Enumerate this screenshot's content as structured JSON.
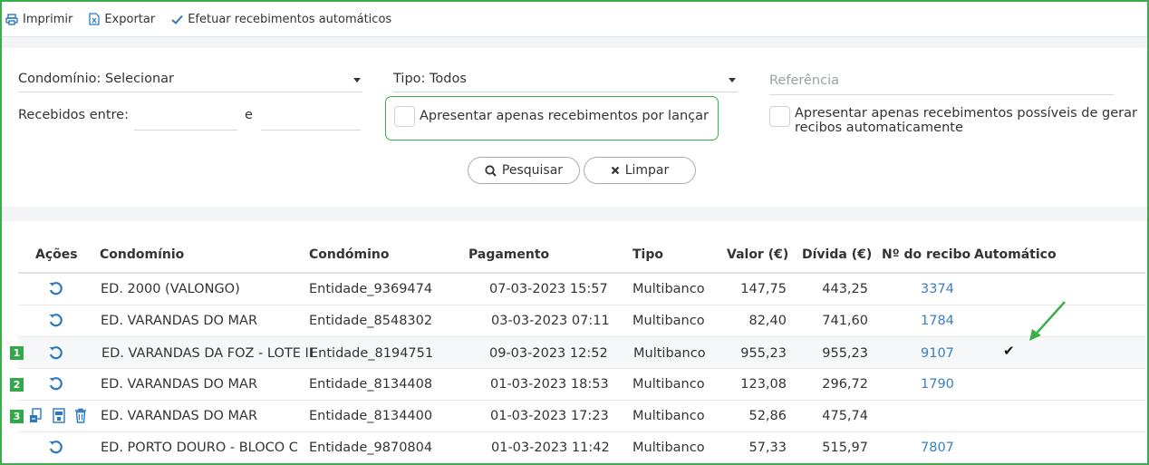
{
  "toolbar": {
    "print": "Imprimir",
    "export": "Exportar",
    "auto_receipts": "Efetuar recebimentos automáticos"
  },
  "filters": {
    "condominio": "Condomínio: Selecionar",
    "tipo": "Tipo: Todos",
    "referencia_placeholder": "Referência",
    "recebidos_entre": "Recebidos entre:",
    "and_label": "e",
    "only_unposted": "Apresentar apenas recebimentos por lançar",
    "only_auto_receipts": "Apresentar apenas recebimentos possíveis de gerar recibos automaticamente",
    "search": "Pesquisar",
    "clear": "Limpar"
  },
  "table": {
    "headers": {
      "acoes": "Ações",
      "condominio": "Condomínio",
      "condomino": "Condómino",
      "pagamento": "Pagamento",
      "tipo": "Tipo",
      "valor": "Valor (€)",
      "divida": "Dívida (€)",
      "recibo": "Nº do recibo",
      "automatico": "Automático"
    },
    "rows": [
      {
        "condominio": "ED. 2000 (VALONGO)",
        "condomino": "Entidade_9369474",
        "pagamento": "07-03-2023 15:57",
        "tipo": "Multibanco",
        "valor": "147,75",
        "divida": "443,25",
        "recibo": "3374"
      },
      {
        "condominio": "ED. VARANDAS DO MAR",
        "condomino": "Entidade_8548302",
        "pagamento": "03-03-2023 07:11",
        "tipo": "Multibanco",
        "valor": "82,40",
        "divida": "741,60",
        "recibo": "1784"
      },
      {
        "badge": "1",
        "condominio": "ED. VARANDAS DA FOZ - LOTE II",
        "condomino": "Entidade_8194751",
        "pagamento": "09-03-2023 12:52",
        "tipo": "Multibanco",
        "valor": "955,23",
        "divida": "955,23",
        "recibo": "9107",
        "automatico": "✔"
      },
      {
        "badge": "2",
        "condominio": "ED. VARANDAS DO MAR",
        "condomino": "Entidade_8134408",
        "pagamento": "01-03-2023 18:53",
        "tipo": "Multibanco",
        "valor": "123,08",
        "divida": "296,72",
        "recibo": "1790"
      },
      {
        "badge": "3",
        "condominio": "ED. VARANDAS DO MAR",
        "condomino": "Entidade_8134400",
        "pagamento": "01-03-2023 17:23",
        "tipo": "Multibanco",
        "valor": "52,86",
        "divida": "475,74",
        "recibo": ""
      },
      {
        "condominio": "ED. PORTO DOURO - BLOCO C",
        "condomino": "Entidade_9870804",
        "pagamento": "01-03-2023 11:42",
        "tipo": "Multibanco",
        "valor": "57,33",
        "divida": "515,97",
        "recibo": "7807"
      }
    ]
  },
  "colors": {
    "accent_green": "#3aae4a",
    "link_blue": "#3a7fc1",
    "icon_blue": "#2c78c0"
  }
}
